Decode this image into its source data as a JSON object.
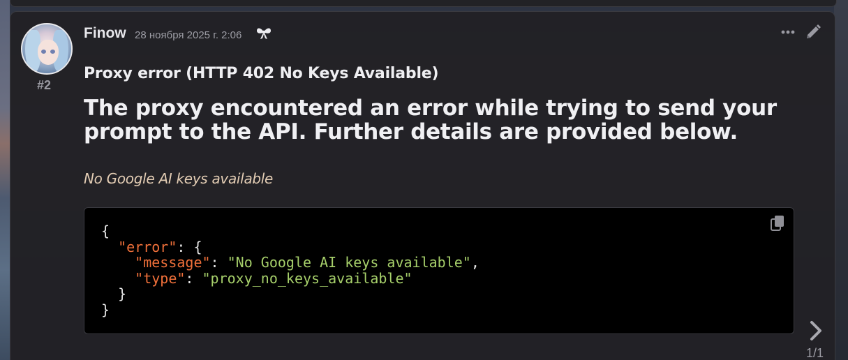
{
  "post": {
    "number": "#2",
    "author": "Finow",
    "timestamp": "28 ноября 2025 г. 2:06",
    "icons": {
      "badge": "bow-icon",
      "more": "more-icon",
      "edit": "pencil-icon",
      "copy": "copy-icon",
      "next": "chevron-right-icon"
    }
  },
  "message": {
    "heading": "Proxy error (HTTP 402 No Keys Available)",
    "lead": "The proxy encountered an error while trying to send your prompt to the API. Further details are provided below.",
    "detail": "No Google AI keys available"
  },
  "code": {
    "open_brace": "{",
    "error_key": "\"error\"",
    "error_sep": ": {",
    "message_key": "\"message\"",
    "message_sep": ": ",
    "message_value": "\"No Google AI keys available\"",
    "message_end": ",",
    "type_key": "\"type\"",
    "type_sep": ": ",
    "type_value": "\"proxy_no_keys_available\"",
    "inner_close": "}",
    "outer_close": "}"
  },
  "pager": {
    "label": "1/1"
  },
  "colors": {
    "card_bg": "#222125",
    "json_key": "#f0703a",
    "json_string": "#a6cf6a",
    "detail_text": "#e3cdb4"
  }
}
